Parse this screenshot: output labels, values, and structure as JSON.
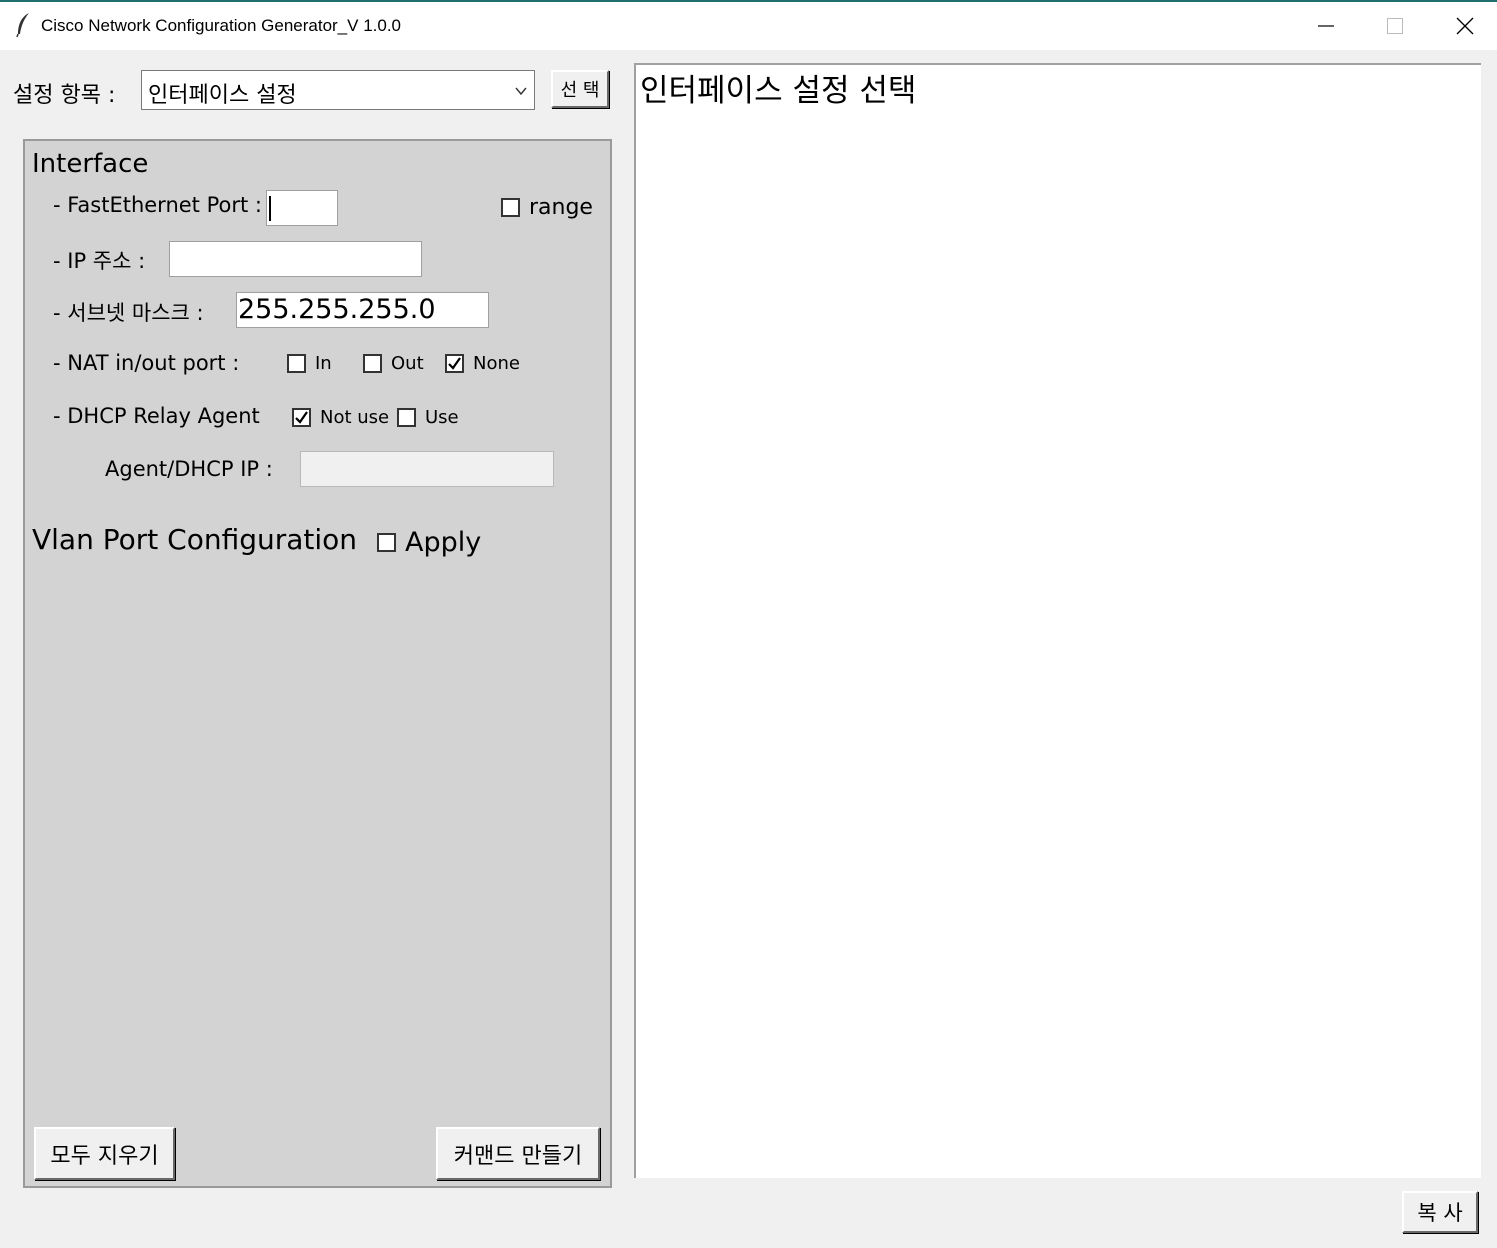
{
  "window": {
    "title": "Cisco Network Configuration Generator_V 1.0.0",
    "icon": "feather-icon",
    "controls": [
      "minimize-icon",
      "maximize-icon",
      "close-icon"
    ]
  },
  "toolbar": {
    "setting_label": "설정 항목 :",
    "combo_value": "인터페이스 설정",
    "select_button": "선 택"
  },
  "interface": {
    "section_title": "Interface",
    "fastethernet_label": "- FastEthernet Port :",
    "fastethernet_value": "",
    "range_label": "range",
    "range_checked": false,
    "ip_label": "- IP 주소 :",
    "ip_value": "",
    "subnet_label": "- 서브넷 마스크 :",
    "subnet_value": "255.255.255.0",
    "nat_label": "- NAT in/out port :",
    "nat_options": [
      {
        "label": "In",
        "checked": false
      },
      {
        "label": "Out",
        "checked": false
      },
      {
        "label": "None",
        "checked": true
      }
    ],
    "dhcp_label": "- DHCP Relay Agent",
    "dhcp_options": [
      {
        "label": "Not use",
        "checked": true
      },
      {
        "label": "Use",
        "checked": false
      }
    ],
    "agent_label": "Agent/DHCP IP :",
    "agent_value": ""
  },
  "vlan": {
    "section_title": "Vlan Port Configuration",
    "apply_label": "Apply",
    "apply_checked": false
  },
  "buttons": {
    "clear_all": "모두 지우기",
    "make_command": "커맨드 만들기",
    "copy": "복 사"
  },
  "output": {
    "text": "인터페이스 설정 선택"
  }
}
